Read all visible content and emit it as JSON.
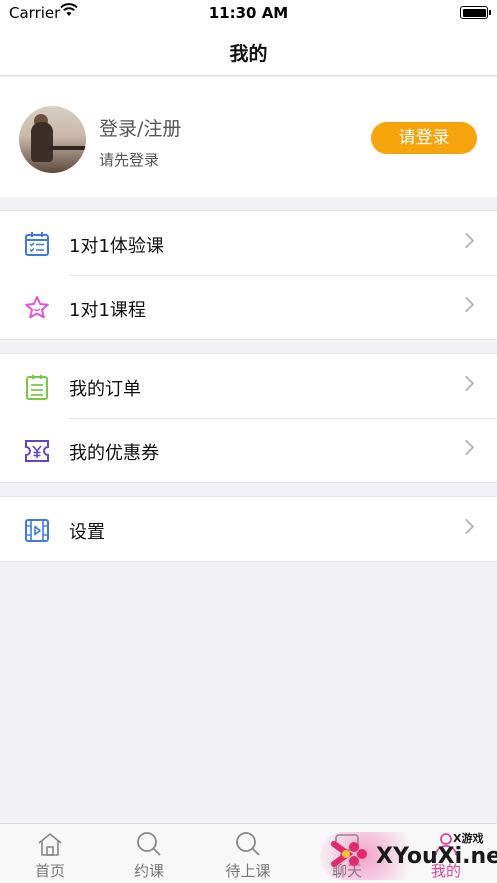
{
  "status_bar": {
    "carrier": "Carrier",
    "time": "11:30 AM"
  },
  "nav": {
    "title": "我的"
  },
  "profile": {
    "name": "登录/注册",
    "hint": "请先登录",
    "login_button": "请登录"
  },
  "groups": [
    {
      "items": [
        {
          "label": "1对1体验课",
          "icon": "calendar-check-icon",
          "color": "#3d7be0"
        },
        {
          "label": "1对1课程",
          "icon": "star-icon",
          "color": "#e057d6"
        }
      ]
    },
    {
      "items": [
        {
          "label": "我的订单",
          "icon": "clipboard-list-icon",
          "color": "#7ac943"
        },
        {
          "label": "我的优惠券",
          "icon": "coupon-yen-icon",
          "color": "#5b49c8"
        }
      ]
    },
    {
      "items": [
        {
          "label": "设置",
          "icon": "video-film-icon",
          "color": "#3d7be0"
        }
      ]
    }
  ],
  "tabs": [
    {
      "label": "首页",
      "icon": "home-icon"
    },
    {
      "label": "约课",
      "icon": "search-icon"
    },
    {
      "label": "待上课",
      "icon": "search-icon"
    },
    {
      "label": "聊天",
      "icon": "chat-icon"
    },
    {
      "label": "我的",
      "icon": "user-icon",
      "active": true
    }
  ],
  "watermark": {
    "text": "XYouXi.net",
    "small": "X游戏"
  },
  "colors": {
    "accent": "#f7a30c",
    "tab_active": "#e0479a",
    "background": "#f2f2f6"
  }
}
